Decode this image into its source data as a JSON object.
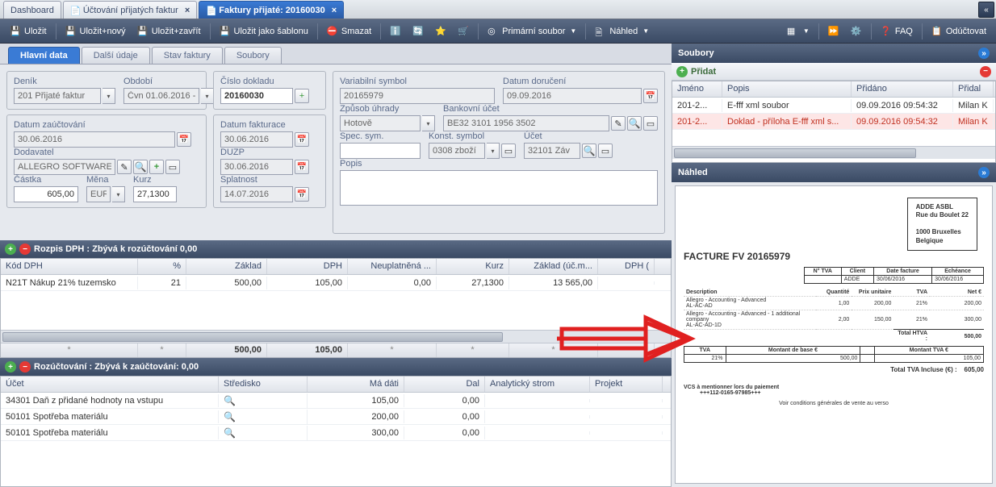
{
  "tabs": [
    {
      "label": "Dashboard",
      "icon": "dashboard"
    },
    {
      "label": "Účtování přijatých faktur",
      "icon": "doc"
    },
    {
      "label": "Faktury přijaté: 20160030",
      "icon": "doc",
      "active": true
    }
  ],
  "toolbar": {
    "save": "Uložit",
    "save_new": "Uložit+nový",
    "save_close": "Uložit+zavřít",
    "save_tmpl": "Uložit jako šablonu",
    "delete": "Smazat",
    "primary_file": "Primární soubor",
    "preview": "Náhled",
    "faq": "FAQ",
    "post": "Odúčtovat"
  },
  "form_tabs": [
    "Hlavní data",
    "Další údaje",
    "Stav faktury",
    "Soubory"
  ],
  "form": {
    "denik_lbl": "Deník",
    "denik_val": "201 Přijaté faktur",
    "obdobi_lbl": "Období",
    "obdobi_val": "Čvn 01.06.2016 -",
    "cislo_lbl": "Číslo dokladu",
    "cislo_val": "20160030",
    "datzau_lbl": "Datum zaúčtování",
    "datzau_val": "30.06.2016",
    "dodav_lbl": "Dodavatel",
    "dodav_val": "ALLEGRO SOFTWARE",
    "castka_lbl": "Částka",
    "castka_val": "605,00",
    "mena_lbl": "Měna",
    "mena_val": "EUR",
    "kurz_lbl": "Kurz",
    "kurz_val": "27,1300",
    "datfak_lbl": "Datum fakturace",
    "datfak_val": "30.06.2016",
    "duzp_lbl": "DUZP",
    "duzp_val": "30.06.2016",
    "splat_lbl": "Splatnost",
    "splat_val": "14.07.2016",
    "vs_lbl": "Variabilní symbol",
    "vs_val": "20165979",
    "ddor_lbl": "Datum doručení",
    "ddor_val": "09.09.2016",
    "zuh_lbl": "Způsob úhrady",
    "zuh_val": "Hotově",
    "bank_lbl": "Bankovní účet",
    "bank_val": "BE32 3101 1956 3502",
    "specsym_lbl": "Spec. sym.",
    "specsym_val": "",
    "ks_lbl": "Konst. symbol",
    "ks_val": "0308 zboží",
    "ucet_lbl": "Účet",
    "ucet_val": "32101 Záv",
    "popis_lbl": "Popis",
    "popis_val": ""
  },
  "vat_section_title": "Rozpis DPH : Zbývá k rozúčtování 0,00",
  "vat_headers": [
    "Kód DPH",
    "%",
    "Základ",
    "DPH",
    "Neuplatněná ...",
    "Kurz",
    "Základ (úč.m...",
    "DPH ("
  ],
  "vat_row": {
    "kod": "N21T Nákup 21% tuzemsko",
    "pct": "21",
    "zaklad": "500,00",
    "dph": "105,00",
    "neup": "0,00",
    "kurz": "27,1300",
    "zakluc": "13 565,00",
    "dphuc": ""
  },
  "vat_foot": [
    "*",
    "*",
    "500,00",
    "105,00",
    "*",
    "*",
    "*",
    ""
  ],
  "acct_section_title": "Rozúčtování : Zbývá k zaúčtování: 0,00",
  "acct_headers": [
    "Účet",
    "Středisko",
    "Má dáti",
    "Dal",
    "Analytický strom",
    "Projekt"
  ],
  "acct_rows": [
    {
      "ucet": "34301 Daň z přidané hodnoty na vstupu",
      "md": "105,00",
      "dal": "0,00"
    },
    {
      "ucet": "50101 Spotřeba materiálu",
      "md": "200,00",
      "dal": "0,00"
    },
    {
      "ucet": "50101 Spotřeba materiálu",
      "md": "300,00",
      "dal": "0,00"
    }
  ],
  "right": {
    "soubory_title": "Soubory",
    "add_label": "Přidat",
    "file_headers": [
      "Jméno",
      "Popis",
      "Přidáno",
      "Přidal"
    ],
    "file_rows": [
      {
        "j": "201-2...",
        "p": "E-fff xml soubor",
        "d": "09.09.2016 09:54:32",
        "a": "Milan K"
      },
      {
        "j": "201-2...",
        "p": "Doklad - příloha E-fff xml s...",
        "d": "09.09.2016 09:54:32",
        "a": "Milan K",
        "sel": true
      }
    ],
    "nahled_title": "Náhled"
  },
  "invoice": {
    "addr1": "ADDE ASBL",
    "addr2": "Rue du Boulet 22",
    "addr3": "1000  Bruxelles",
    "addr4": "Belgique",
    "title": "FACTURE     FV 20165979",
    "th_ntva": "N° TVA",
    "th_client": "Client",
    "th_date": "Date facture",
    "th_ech": "Echéance",
    "td_ntva": "",
    "td_client": "ADDE",
    "td_date": "30/06/2016",
    "td_ech": "30/06/2016",
    "lh_desc": "Description",
    "lh_q": "Quantité",
    "lh_pu": "Prix unitaire",
    "lh_tva": "TVA",
    "lh_net": "Net €",
    "l1_desc": "Allegro - Accounting - Advanced\nAL-AC-AD",
    "l1_q": "1,00",
    "l1_pu": "200,00",
    "l1_tva": "21%",
    "l1_net": "200,00",
    "l2_desc": "Allegro - Accounting - Advanced - 1 additional company\nAL-AC-AD-1D",
    "l2_q": "2,00",
    "l2_pu": "150,00",
    "l2_tva": "21%",
    "l2_net": "300,00",
    "tot_htva_lbl": "Total HTVA :",
    "tot_htva": "500,00",
    "tva_lbl": "TVA",
    "base_lbl": "Montant de base €",
    "mtva_lbl": "Montant TVA €",
    "tva_pct": "21%",
    "tva_base": "500,00",
    "tva_amt": "105,00",
    "tot_incl_lbl": "Total TVA Incluse (€) :",
    "tot_incl": "605,00",
    "vcs_lbl": "VCS à mentionner lors du paiement",
    "vcs": "+++112-0165-97985+++",
    "footer": "Voir conditions générales de vente au verso"
  }
}
